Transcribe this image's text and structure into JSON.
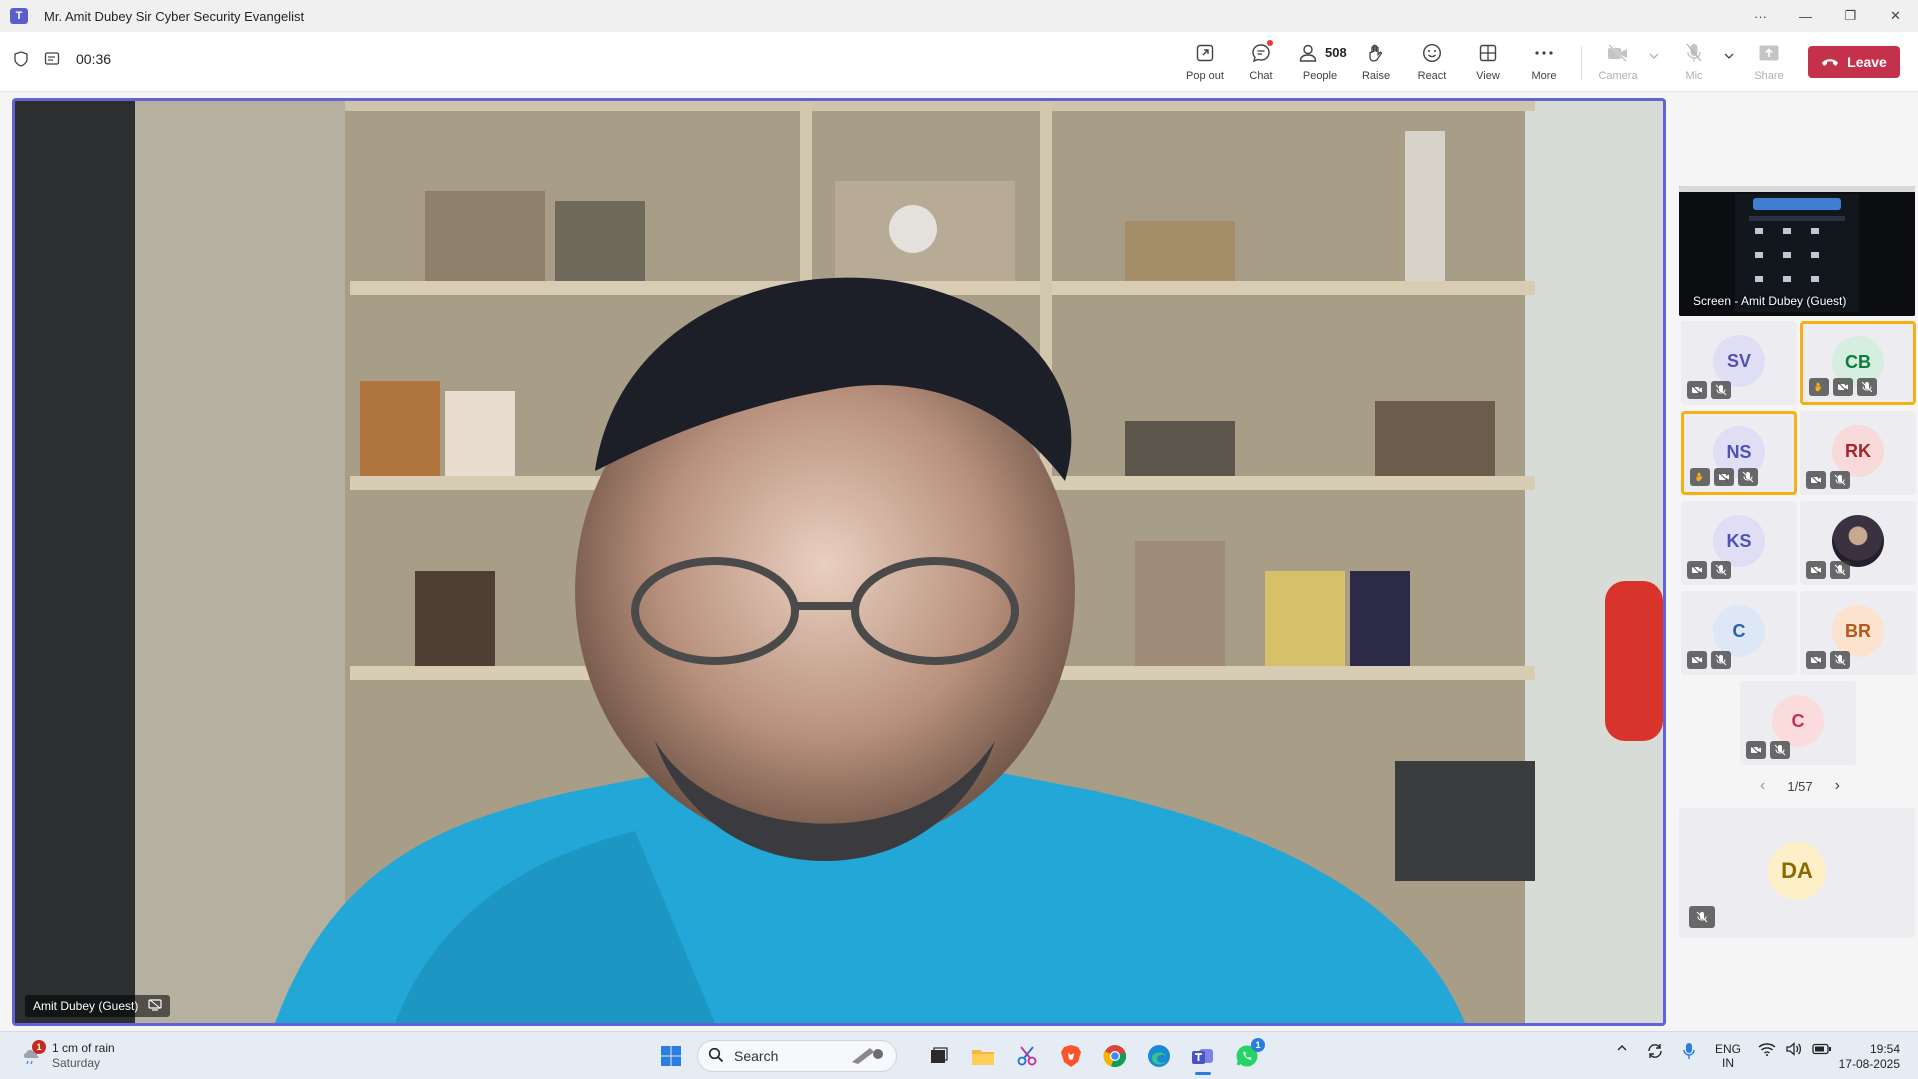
{
  "window": {
    "title": "Mr. Amit Dubey Sir Cyber Security Evangelist",
    "minimize_glyph": "—",
    "restore_glyph": "❐",
    "close_glyph": "✕",
    "more_glyph": "···"
  },
  "toolbar": {
    "timer": "00:36",
    "pop_out_label": "Pop out",
    "chat_label": "Chat",
    "people_label": "People",
    "people_count": "508",
    "raise_label": "Raise",
    "react_label": "React",
    "view_label": "View",
    "more_label": "More",
    "camera_label": "Camera",
    "mic_label": "Mic",
    "share_label": "Share",
    "leave_label": "Leave"
  },
  "main_video": {
    "speaker_name": "Amit Dubey (Guest)"
  },
  "sidebar": {
    "screen_share_label": "Screen - Amit Dubey (Guest)",
    "participants": [
      {
        "initials": "SV",
        "hand_raised": false,
        "bg": "#e0def4",
        "fg": "#4f52b2"
      },
      {
        "initials": "CB",
        "hand_raised": true,
        "bg": "#d6eedf",
        "fg": "#0e7a3e"
      },
      {
        "initials": "NS",
        "hand_raised": true,
        "bg": "#e0def4",
        "fg": "#4f52b2"
      },
      {
        "initials": "RK",
        "hand_raised": false,
        "bg": "#f8dada",
        "fg": "#a4262c"
      },
      {
        "initials": "KS",
        "hand_raised": false,
        "bg": "#e0def4",
        "fg": "#4f52b2"
      },
      {
        "initials": "",
        "hand_raised": false,
        "bg": "#3a3a4a",
        "fg": "#ffffff"
      },
      {
        "initials": "C",
        "hand_raised": false,
        "bg": "#dde7f6",
        "fg": "#2b5fa8"
      },
      {
        "initials": "BR",
        "hand_raised": false,
        "bg": "#fbe3cf",
        "fg": "#b4581b"
      },
      {
        "initials": "C",
        "hand_raised": false,
        "bg": "#fbdcdc",
        "fg": "#c4314b"
      }
    ],
    "pager": {
      "text": "1/57",
      "prev_glyph": "‹",
      "next_glyph": "›"
    },
    "self_tile": {
      "initials": "DA",
      "bg": "#fdf0c8",
      "fg": "#8a6a00"
    }
  },
  "taskbar": {
    "weather_text": "1 cm of rain",
    "weather_sub": "Saturday",
    "weather_badge": "1",
    "search_placeholder": "Search",
    "whatsapp_badge": "1",
    "lang_line1": "ENG",
    "lang_line2": "IN",
    "time": "19:54",
    "date": "17-08-2025"
  },
  "colors": {
    "accent": "#6264d4",
    "leave": "#c4314b",
    "hand_raise": "#f6b012"
  }
}
